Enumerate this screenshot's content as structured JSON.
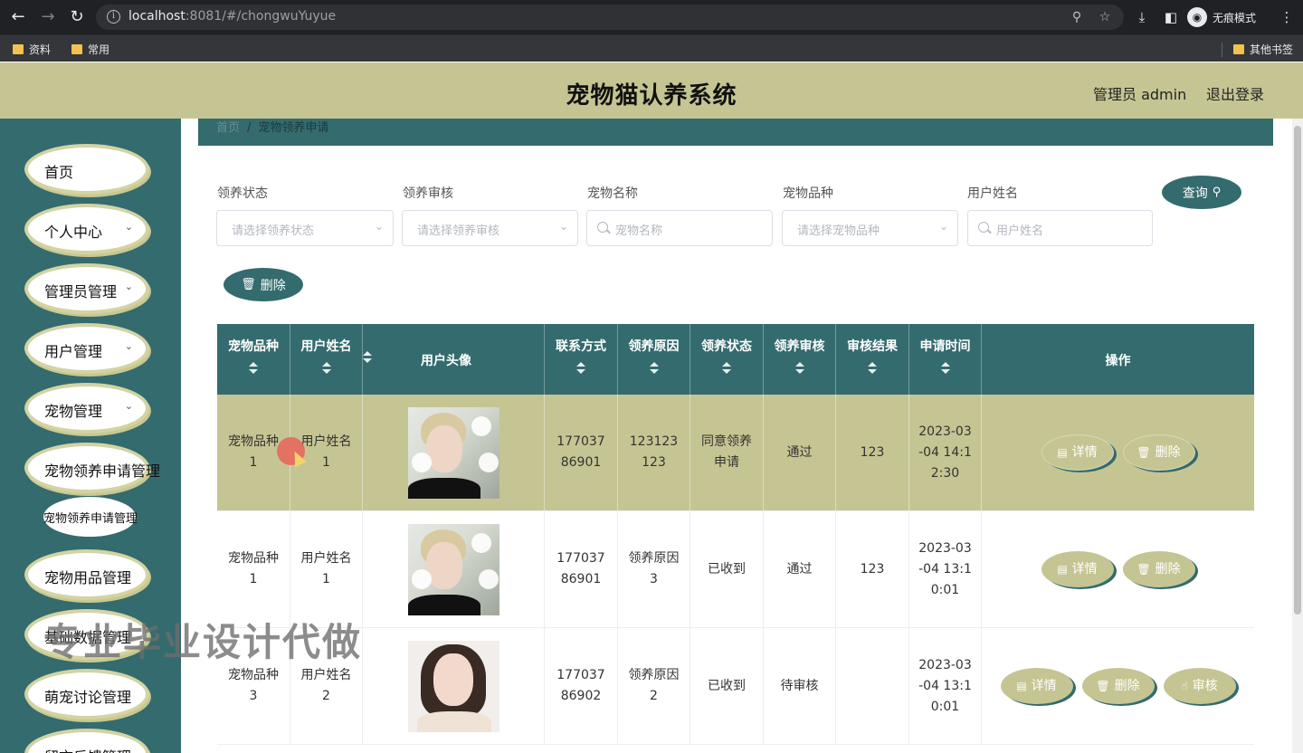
{
  "browser": {
    "url_host": "localhost",
    "url_rest": ":8081/#/chongwuYuyue",
    "incognito_label": "无痕模式",
    "bookmarks": [
      "资料",
      "常用"
    ],
    "other_bookmarks": "其他书签"
  },
  "header": {
    "title": "宠物猫认养系统",
    "admin": "管理员 admin",
    "logout": "退出登录"
  },
  "sidebar": {
    "items": [
      {
        "label": "首页",
        "has_chevron": false
      },
      {
        "label": "个人中心",
        "has_chevron": true
      },
      {
        "label": "管理员管理",
        "has_chevron": true
      },
      {
        "label": "用户管理",
        "has_chevron": true
      },
      {
        "label": "宠物管理",
        "has_chevron": true
      },
      {
        "label": "宠物领养申请管理",
        "has_chevron": false
      },
      {
        "label": "宠物用品管理",
        "has_chevron": false
      },
      {
        "label": "基础数据管理",
        "has_chevron": false
      },
      {
        "label": "萌宠讨论管理",
        "has_chevron": false
      },
      {
        "label": "留言反馈管理",
        "has_chevron": false
      }
    ],
    "submenu": "宠物领养申请管理"
  },
  "breadcrumb": {
    "home": "首页",
    "current": "宠物领养申请"
  },
  "filters": {
    "adopt_status": {
      "label": "领养状态",
      "placeholder": "请选择领养状态"
    },
    "adopt_review": {
      "label": "领养审核",
      "placeholder": "请选择领养审核"
    },
    "pet_name": {
      "label": "宠物名称",
      "placeholder": "宠物名称"
    },
    "pet_breed": {
      "label": "宠物品种",
      "placeholder": "请选择宠物品种"
    },
    "user_name": {
      "label": "用户姓名",
      "placeholder": "用户姓名"
    },
    "query_button": "查询",
    "delete_button": "删除"
  },
  "table": {
    "columns": [
      "宠物品种",
      "用户姓名",
      "用户头像",
      "联系方式",
      "领养原因",
      "领养状态",
      "领养审核",
      "审核结果",
      "申请时间",
      "操作"
    ],
    "rows": [
      {
        "breed": "宠物品种1",
        "user": "用户姓名1",
        "avatar": "boy",
        "phone": "17703786901",
        "reason": "123123123",
        "status": "同意领养申请",
        "review": "通过",
        "result": "123",
        "time": "2023-03-04 14:12:30",
        "actions": [
          "详情",
          "删除"
        ]
      },
      {
        "breed": "宠物品种1",
        "user": "用户姓名1",
        "avatar": "boy",
        "phone": "17703786901",
        "reason": "领养原因3",
        "status": "已收到",
        "review": "通过",
        "result": "123",
        "time": "2023-03-04 13:10:01",
        "actions": [
          "详情",
          "删除"
        ]
      },
      {
        "breed": "宠物品种3",
        "user": "用户姓名2",
        "avatar": "girl",
        "phone": "17703786902",
        "reason": "领养原因2",
        "status": "已收到",
        "review": "待审核",
        "result": "",
        "time": "2023-03-04 13:10:01",
        "actions": [
          "详情",
          "删除",
          "审核"
        ]
      }
    ]
  },
  "watermark": "专业毕业设计代做",
  "colors": {
    "primary": "#336b6e",
    "accent": "#c5c593"
  }
}
